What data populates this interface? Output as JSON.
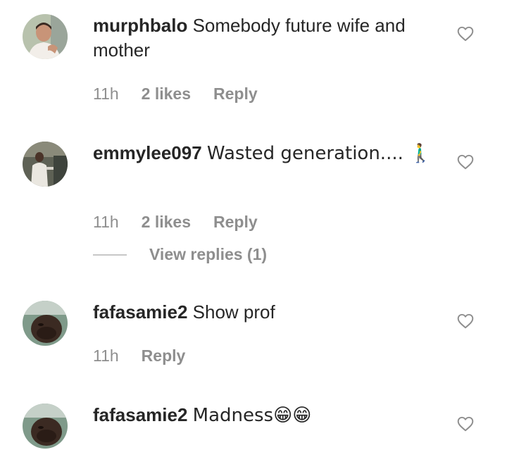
{
  "comments": [
    {
      "username": "murphbalo",
      "text": "Somebody future wife and mother",
      "time": "11h",
      "likes": "2 likes",
      "reply": "Reply",
      "avatar_icon": "person-white-shirt-avatar",
      "liked": false
    },
    {
      "username": "emmylee097",
      "text": "Wasted generation.... 🚶‍♂️",
      "time": "11h",
      "likes": "2 likes",
      "reply": "Reply",
      "view_replies": "View replies (1)",
      "avatar_icon": "person-white-robe-avatar",
      "liked": false
    },
    {
      "username": "fafasamie2",
      "text": "Show prof",
      "time": "11h",
      "reply": "Reply",
      "avatar_icon": "dark-face-avatar",
      "liked": false
    },
    {
      "username": "fafasamie2",
      "text": "Madness😁😁",
      "avatar_icon": "dark-face-avatar",
      "liked": false
    }
  ],
  "colors": {
    "text": "#262626",
    "meta": "#8e8e8e",
    "heart_outline": "#8e8e8e"
  }
}
